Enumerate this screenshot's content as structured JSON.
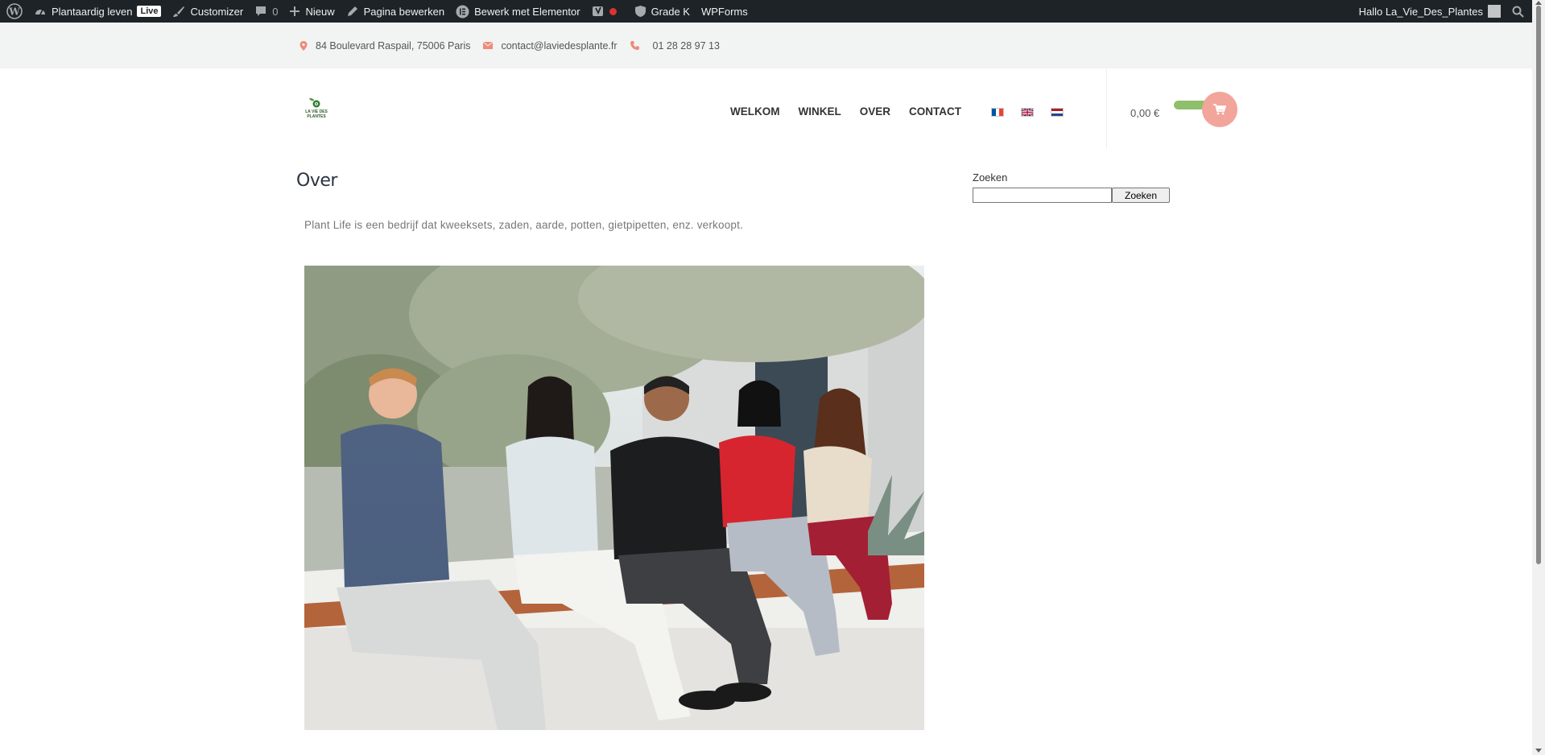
{
  "admin_bar": {
    "site_name": "Plantaardig leven",
    "live_badge": "Live",
    "customizer": "Customizer",
    "comments_count": "0",
    "new": "Nieuw",
    "edit_page": "Pagina bewerken",
    "elementor": "Bewerk met Elementor",
    "grade": "Grade K",
    "wpforms": "WPForms",
    "greeting": "Hallo La_Vie_Des_Plantes"
  },
  "topbar": {
    "address": "84 Boulevard Raspail, 75006 Paris",
    "email": "contact@laviedesplante.fr",
    "phone": "01 28 28 97 13",
    "icon_color": "#f08a7a"
  },
  "header": {
    "logo_text": "LA VIE DES PLANTES",
    "nav": [
      "WELKOM",
      "WINKEL",
      "OVER",
      "CONTACT"
    ],
    "languages": [
      "fr-flag-icon",
      "en-flag-icon",
      "nl-flag-icon"
    ],
    "cart_total": "0,00 €"
  },
  "main": {
    "title": "Over",
    "intro": "Plant Life is een bedrijf dat kweeksets, zaden, aarde, potten, gietpipetten, enz. verkoopt."
  },
  "sidebar": {
    "search_label": "Zoeken",
    "search_value": "",
    "search_button": "Zoeken"
  },
  "colors": {
    "admin_bg": "#1d2327",
    "topbar_bg": "#f1f4f2",
    "accent_pink": "#f2a59a",
    "accent_green": "#8fbf6a"
  }
}
